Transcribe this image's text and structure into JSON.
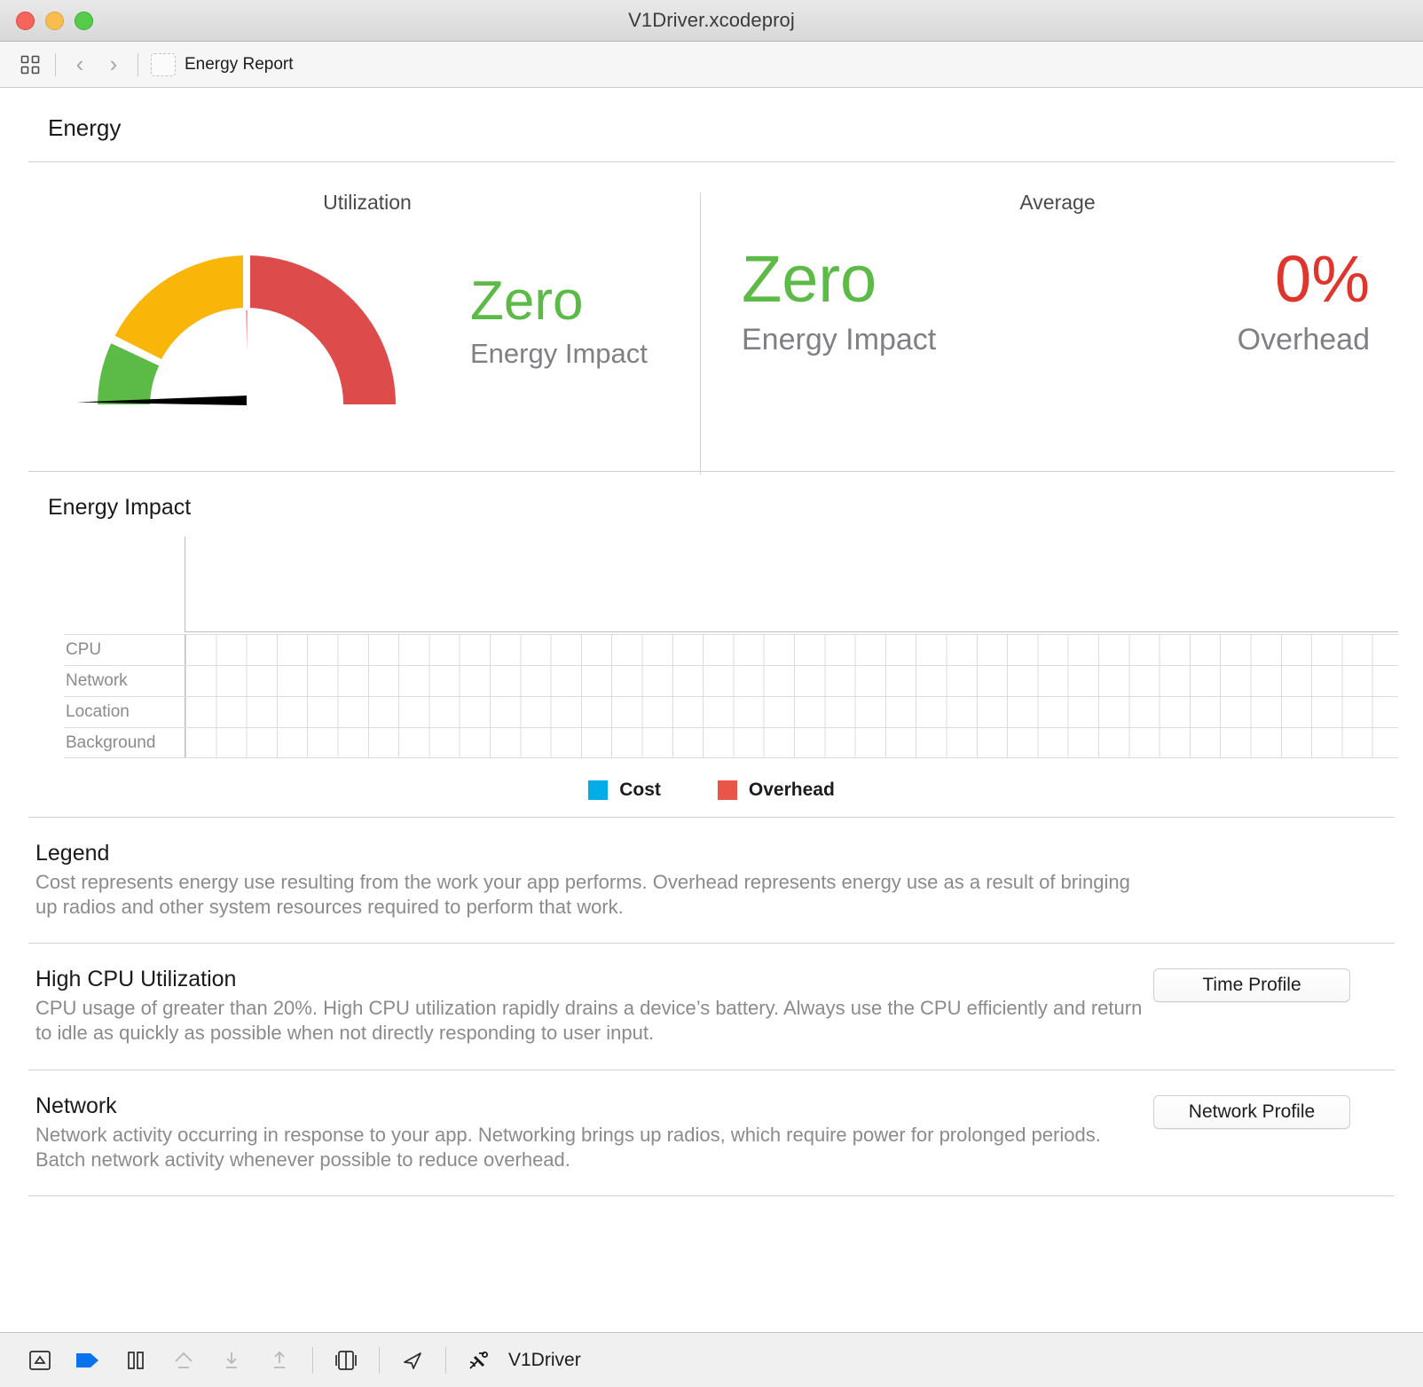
{
  "window": {
    "title": "V1Driver.xcodeproj",
    "traffic_lights": [
      "close-button",
      "minimize-button",
      "maximize-button"
    ]
  },
  "navbar": {
    "grid_icon": "project-navigator-icon",
    "back_icon": "chevron-left-icon",
    "forward_icon": "chevron-right-icon",
    "breadcrumb": "Energy Report"
  },
  "page": {
    "title": "Energy"
  },
  "summary": {
    "utilization": {
      "heading": "Utilization",
      "value": "Zero",
      "caption": "Energy Impact",
      "value_color": "#5cba47"
    },
    "average": {
      "heading": "Average",
      "impact_value": "Zero",
      "impact_caption": "Energy Impact",
      "impact_color": "#5cba47",
      "overhead_value": "0%",
      "overhead_caption": "Overhead",
      "overhead_color": "#e0352c"
    },
    "gauge": {
      "name": "energy-gauge",
      "green_color": "#5cba47",
      "yellow_color": "#f9b508",
      "red_color": "#dd4b4b",
      "needle_color": "#000000",
      "needle_position": "zero"
    }
  },
  "chart_data": {
    "type": "bar",
    "title": "Energy Impact",
    "categories": [
      "CPU",
      "Network",
      "Location",
      "Background"
    ],
    "series": [
      {
        "name": "Cost",
        "color": "#00ade6",
        "values": [
          0,
          0,
          0,
          0
        ]
      },
      {
        "name": "Overhead",
        "color": "#e8564a",
        "values": [
          0,
          0,
          0,
          0
        ]
      }
    ],
    "xlabel": "",
    "ylabel": "",
    "ylim": [
      0,
      0
    ],
    "grid": true,
    "grid_columns": 41,
    "legend_position": "bottom"
  },
  "chart": {
    "title": "Energy Impact",
    "rows": [
      "CPU",
      "Network",
      "Location",
      "Background"
    ],
    "legend": [
      {
        "label": "Cost",
        "color": "#00ade6"
      },
      {
        "label": "Overhead",
        "color": "#e8564a"
      }
    ]
  },
  "sections": [
    {
      "title": "Legend",
      "body": "Cost represents energy use resulting from the work your app performs. Overhead represents energy use as a result of bringing up radios and other system resources required to perform that work.",
      "button": null
    },
    {
      "title": "High CPU Utilization",
      "body": "CPU usage of greater than 20%. High CPU utilization rapidly drains a device’s battery.  Always use the CPU efficiently and return to idle as quickly as possible when not directly responding to user input.",
      "button": "Time Profile"
    },
    {
      "title": "Network",
      "body": "Network activity occurring in response to your app.  Networking brings up radios, which require power for prolonged periods. Batch network activity whenever possible to reduce overhead.",
      "button": "Network Profile"
    }
  ],
  "debugbar": {
    "buttons": [
      "hide-debug-area-icon",
      "continue-execution-icon",
      "pause-icon",
      "step-over-icon",
      "step-into-icon",
      "step-out-icon",
      "view-debugging-icon",
      "location-simulation-icon"
    ],
    "scheme_icon": "satellite-icon",
    "scheme_label": "V1Driver",
    "continue_color": "#0b72ed"
  }
}
